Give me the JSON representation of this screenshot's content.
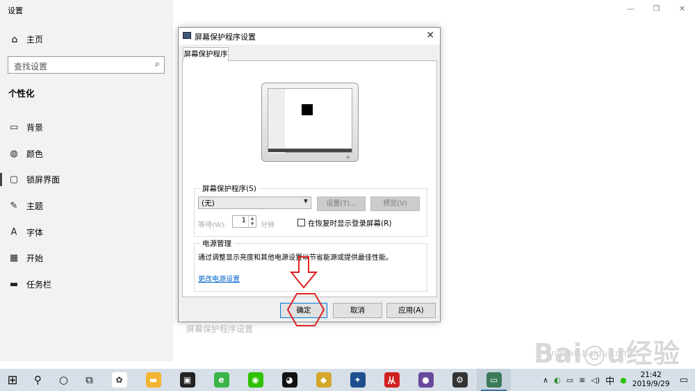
{
  "window": {
    "title": "设置",
    "controls": {
      "minimize": "—",
      "maximize": "❐",
      "close": "✕"
    }
  },
  "sidebar": {
    "home": "主页",
    "search_placeholder": "查找设置",
    "section": "个性化",
    "items": [
      {
        "label": "背景",
        "icon": "picture-icon",
        "glyph": "▭"
      },
      {
        "label": "颜色",
        "icon": "palette-icon",
        "glyph": "◍"
      },
      {
        "label": "锁屏界面",
        "icon": "lock-screen-icon",
        "glyph": "▢"
      },
      {
        "label": "主题",
        "icon": "theme-icon",
        "glyph": "✎"
      },
      {
        "label": "字体",
        "icon": "font-icon",
        "glyph": "A"
      },
      {
        "label": "开始",
        "icon": "start-icon",
        "glyph": "▦"
      },
      {
        "label": "任务栏",
        "icon": "taskbar-icon",
        "glyph": "▬"
      }
    ],
    "active_index": 2
  },
  "main": {
    "faded_link": "屏幕保护程序设置"
  },
  "dialog": {
    "title": "屏幕保护程序设置",
    "tab": "屏幕保护程序",
    "screensaver_group": "屏幕保护程序(S)",
    "screensaver_value": "(无)",
    "settings_button": "设置(T)...",
    "preview_button": "预览(V)",
    "wait_label": "等待(W):",
    "wait_value": "1",
    "minutes_label": "分钟",
    "resume_checkbox": "在恢复时显示登录屏幕(R)",
    "resume_checked": false,
    "power_group": "电源管理",
    "power_text": "通过调整显示亮度和其他电源设置以节省能源或提供最佳性能。",
    "power_link": "更改电源设置",
    "ok": "确定",
    "cancel": "取消",
    "apply": "应用(A)"
  },
  "annotation_color": "#e02020",
  "watermark": {
    "brand": "Baidu经验",
    "url": "jingyan.baidu.com"
  },
  "taskbar": {
    "apps": [
      {
        "name": "pinwheel-app-icon",
        "glyph": "✿",
        "color": "#ffffff"
      },
      {
        "name": "file-explorer-icon",
        "glyph": "▬",
        "color": "#f2b531"
      },
      {
        "name": "store-icon",
        "glyph": "▣",
        "color": "#222222"
      },
      {
        "name": "browser-icon",
        "glyph": "e",
        "color": "#3bb449"
      },
      {
        "name": "wechat-icon",
        "glyph": "◉",
        "color": "#2dc100"
      },
      {
        "name": "qq-icon",
        "glyph": "◕",
        "color": "#111111"
      },
      {
        "name": "badge-app-icon",
        "glyph": "◆",
        "color": "#d4a72c"
      },
      {
        "name": "puzzle-app-icon",
        "glyph": "✦",
        "color": "#1e4f8f"
      },
      {
        "name": "red-app-icon",
        "glyph": "从",
        "color": "#d02020"
      },
      {
        "name": "galaxy-app-icon",
        "glyph": "●",
        "color": "#6a4a9a"
      },
      {
        "name": "settings-app-icon",
        "glyph": "⚙",
        "color": "#333333"
      },
      {
        "name": "screen-app-icon",
        "glyph": "▭",
        "color": "#3a7a5a"
      }
    ],
    "active_app_index": 11,
    "tray": {
      "ime": "中",
      "time": "21:42",
      "date": "2019/9/29"
    }
  }
}
